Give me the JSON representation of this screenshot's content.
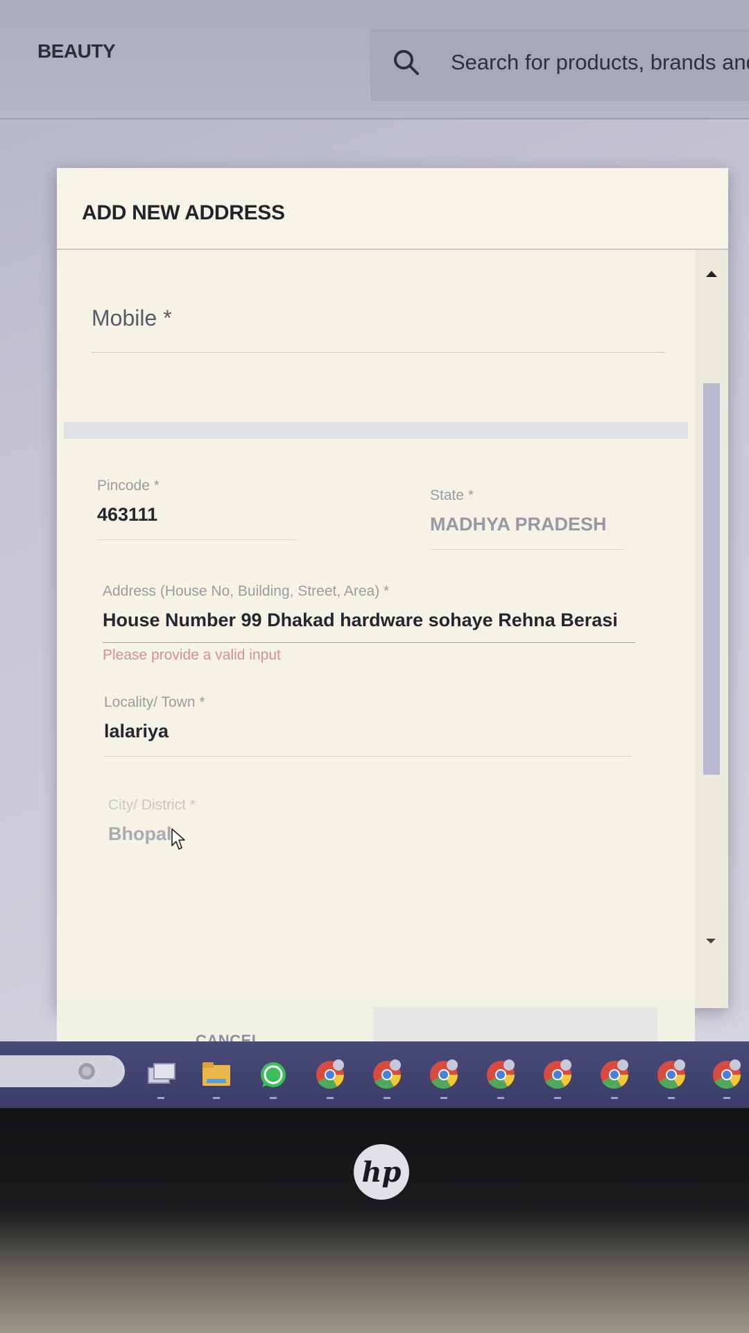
{
  "header": {
    "nav_label": "BEAUTY",
    "search_placeholder": "Search for products, brands and more"
  },
  "modal": {
    "title": "ADD NEW ADDRESS",
    "fields": {
      "mobile": {
        "label": "Mobile *",
        "value": ""
      },
      "pincode": {
        "label": "Pincode *",
        "value": "463111"
      },
      "state": {
        "label": "State *",
        "value": "MADHYA PRADESH"
      },
      "address": {
        "label": "Address (House No, Building, Street, Area) *",
        "value": "House Number 99 Dhakad hardware sohaye Rehna Berasi",
        "error": "Please provide a valid input"
      },
      "locality": {
        "label": "Locality/ Town *",
        "value": "lalariya"
      },
      "city": {
        "label": "City/ District *",
        "value": "Bhopal"
      }
    },
    "buttons": {
      "cancel": "CANCEL",
      "save": ""
    }
  },
  "taskbar": {
    "icons": [
      "taskbar-search-icon",
      "task-view-icon",
      "file-explorer-icon",
      "whatsapp-icon",
      "chrome-icon",
      "chrome-icon",
      "chrome-icon",
      "chrome-icon",
      "chrome-icon",
      "chrome-icon",
      "chrome-icon",
      "chrome-icon"
    ]
  },
  "colors": {
    "modal_bg": "#f4f3e6",
    "error": "#d98a8a",
    "taskbar": "#44446f"
  }
}
